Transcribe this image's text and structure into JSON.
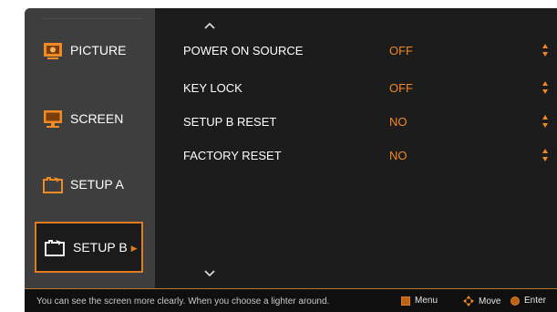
{
  "sidebar": {
    "items": [
      {
        "label": "PICTURE",
        "icon": "picture-icon"
      },
      {
        "label": "SCREEN",
        "icon": "screen-icon"
      },
      {
        "label": "SETUP A",
        "icon": "setup-icon"
      },
      {
        "label": "SETUP B",
        "icon": "setup-icon",
        "active": true
      }
    ]
  },
  "settings": {
    "rows": [
      {
        "name": "POWER ON SOURCE",
        "value": "OFF"
      },
      {
        "name": "KEY LOCK",
        "value": "OFF"
      },
      {
        "name": "SETUP B RESET",
        "value": "NO"
      },
      {
        "name": "FACTORY RESET",
        "value": "NO"
      }
    ]
  },
  "footer": {
    "hint": "You can see the screen more clearly. When you choose a lighter around.",
    "menu_label": "Menu",
    "move_label": "Move",
    "enter_label": "Enter"
  },
  "colors": {
    "accent": "#f08a24",
    "panel": "#1c1c1c",
    "sidebar": "#3e3e3e"
  }
}
